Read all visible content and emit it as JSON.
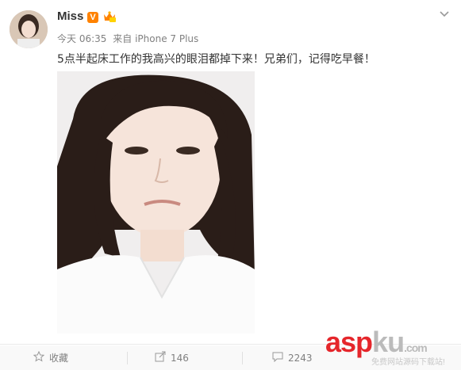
{
  "post": {
    "username": "Miss",
    "vip_label": "V",
    "time": "今天 06:35",
    "source_prefix": "来自",
    "source": "iPhone 7 Plus",
    "text": "5点半起床工作的我高兴的眼泪都掉下来！兄弟们，记得吃早餐！"
  },
  "actions": {
    "favorite_label": "收藏",
    "repost_count": "146",
    "comment_count": "2243"
  },
  "watermark": {
    "main_red": "asp",
    "main_gray": "ku",
    "main_suffix": ".com",
    "sub": "免费网站源码下载站!"
  },
  "colors": {
    "brand_orange": "#ff8200",
    "text_gray": "#808080",
    "watermark_red": "#e5262b"
  }
}
